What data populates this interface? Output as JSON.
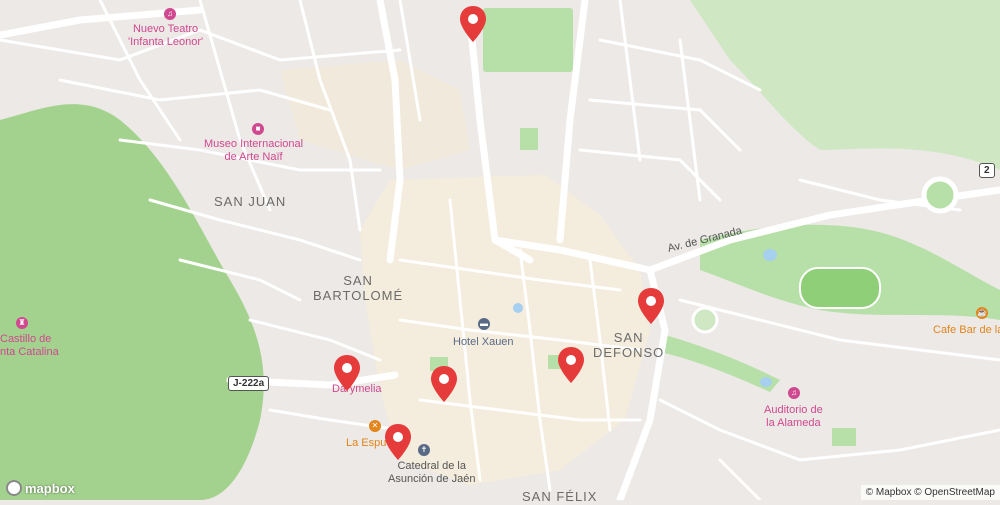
{
  "map": {
    "districts": [
      "SAN JUAN",
      "SAN",
      "BARTOLOMÉ",
      "SAN",
      "DEFONSO",
      "SAN FÉLIX"
    ],
    "pois": {
      "teatro": [
        "Nuevo Teatro",
        "'Infanta Leonor'"
      ],
      "museo": [
        "Museo Internacional",
        "de Arte Naïf"
      ],
      "castillo": [
        "Castillo de",
        "nta Catalina"
      ],
      "hotel": "Hotel Xauen",
      "darymelia": "Darymelia",
      "espuela": "La Espue",
      "catedral": [
        "Catedral de la",
        "Asunción de Jaén"
      ],
      "auditorio": [
        "Auditorio de",
        "la Alameda"
      ],
      "cafe": "Cafe Bar de la"
    },
    "roads": {
      "granada": "Av. de Granada",
      "j222a": "J-222a",
      "two": "2"
    },
    "markers": [
      "marker-1",
      "marker-2",
      "marker-3",
      "marker-4",
      "marker-5",
      "marker-6",
      "marker-7"
    ],
    "colors": {
      "land": "#ece9e6",
      "park": "#b7e0a8",
      "hill": "#9fd08a",
      "road": "#ffffff",
      "marker": "#e63b3b",
      "pink": "#d0488f",
      "orange": "#e2851b"
    }
  },
  "footer": {
    "attribution": "© Mapbox © OpenStreetMap",
    "logo": "mapbox"
  }
}
